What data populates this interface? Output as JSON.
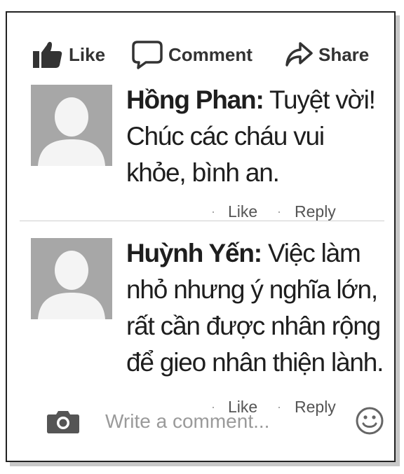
{
  "actions": {
    "like": "Like",
    "comment": "Comment",
    "share": "Share"
  },
  "comments": [
    {
      "author": "Hồng Phan:",
      "text": "Tuyệt vời! Chúc các cháu vui khỏe, bình an.",
      "like": "Like",
      "reply": "Reply"
    },
    {
      "author": "Huỳnh Yến:",
      "text": "Việc làm nhỏ nhưng ý nghĩa lớn, rất cần được nhân rộng để gieo nhân thiện lành.",
      "like": "Like",
      "reply": "Reply"
    }
  ],
  "composer": {
    "placeholder": "Write a comment..."
  },
  "icons": {
    "like": "thumbs-up-icon",
    "comment": "speech-bubble-icon",
    "share": "share-arrow-icon",
    "camera": "camera-icon",
    "emoji": "smiley-icon",
    "avatar": "default-avatar-icon"
  },
  "colors": {
    "icon": "#333333",
    "avatar_bg": "#a7a7a7",
    "placeholder": "#9a9a9a"
  }
}
